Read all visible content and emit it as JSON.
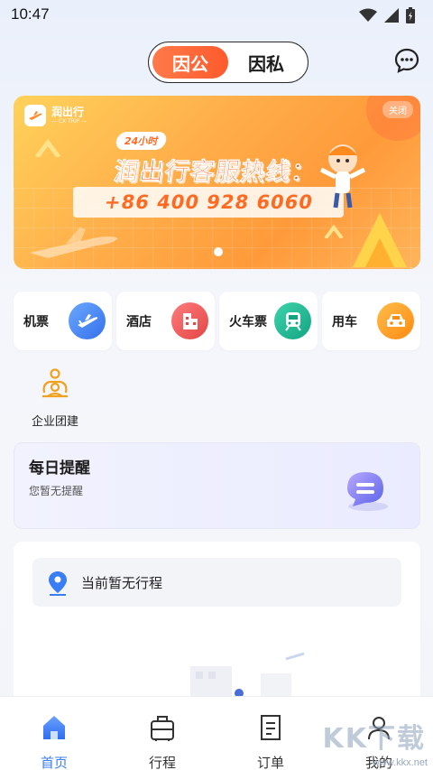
{
  "status_bar": {
    "time": "10:47",
    "icons": [
      "wifi-icon",
      "signal-icon",
      "battery-icon"
    ]
  },
  "header": {
    "mode_active": "因公",
    "mode_inactive": "因私",
    "message_icon": "chat-icon"
  },
  "banner": {
    "brand": "润出行",
    "brand_sub": "— CX TRIP —",
    "close_label": "关闭",
    "badge": "24小时",
    "title": "润出行客服热线：",
    "phone": "+86 400 928 6060"
  },
  "services": [
    {
      "label": "机票",
      "icon": "airplane-icon",
      "color": "#3b7cf0"
    },
    {
      "label": "酒店",
      "icon": "hotel-icon",
      "color": "#ee5555"
    },
    {
      "label": "火车票",
      "icon": "train-icon",
      "color": "#1fb48f"
    },
    {
      "label": "用车",
      "icon": "car-icon",
      "color": "#ff9c1e"
    }
  ],
  "team_build": {
    "label": "企业团建",
    "icon": "team-icon"
  },
  "reminder": {
    "title": "每日提醒",
    "text": "您暂无提醒"
  },
  "trip": {
    "empty_text": "当前暂无行程"
  },
  "bottom_nav": [
    {
      "label": "首页",
      "icon": "home-icon",
      "active": true
    },
    {
      "label": "行程",
      "icon": "luggage-icon",
      "active": false
    },
    {
      "label": "订单",
      "icon": "document-icon",
      "active": false
    },
    {
      "label": "我的",
      "icon": "profile-icon",
      "active": false
    }
  ],
  "watermark": {
    "big": "KK下载",
    "small": "www.kkx.net"
  }
}
